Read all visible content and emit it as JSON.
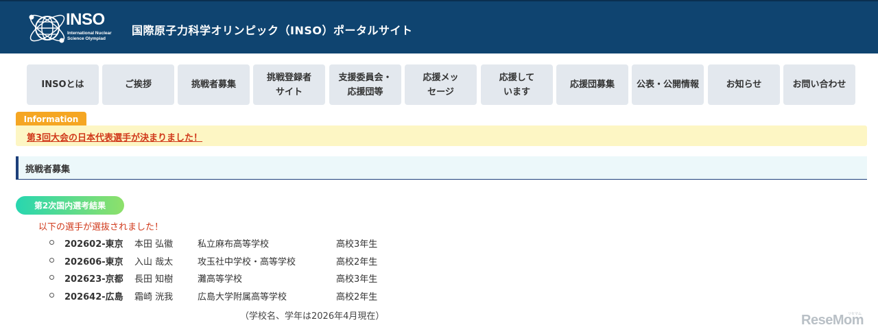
{
  "header": {
    "logo_text": "INSO",
    "logo_sub": "International Nuclear Science Olympiad",
    "site_title": "国際原子力科学オリンピック（INSO）ポータルサイト"
  },
  "nav": [
    {
      "label": "INSOとは"
    },
    {
      "label": "ご挨拶"
    },
    {
      "label": "挑戦者募集"
    },
    {
      "label": "挑戦登録者\nサイト"
    },
    {
      "label": "支援委員会・\n応援団等"
    },
    {
      "label": "応援メッ\nセージ"
    },
    {
      "label": "応援して\nいます"
    },
    {
      "label": "応援団募集"
    },
    {
      "label": "公表・公開情報"
    },
    {
      "label": "お知らせ"
    },
    {
      "label": "お問い合わせ"
    }
  ],
  "info": {
    "tab_label": "Information",
    "link_text": "第3回大会の日本代表選手が決まりました！"
  },
  "section": {
    "heading": "挑戦者募集",
    "pill": "第2次国内選考結果",
    "notice": "以下の選手が選抜されました！",
    "entries": [
      {
        "id": "202602-東京",
        "name": "本田 弘徽",
        "school": "私立麻布高等学校",
        "grade": "高校3年生"
      },
      {
        "id": "202606-東京",
        "name": "入山 哉太",
        "school": "攻玉社中学校・高等学校",
        "grade": "高校2年生"
      },
      {
        "id": "202623-京都",
        "name": "長田 知樹",
        "school": "灘高等学校",
        "grade": "高校3年生"
      },
      {
        "id": "202642-広島",
        "name": "霜崎 洸我",
        "school": "広島大学附属高等学校",
        "grade": "高校2年生"
      }
    ],
    "footnote": "（学校名、学年は2026年4月現在）"
  },
  "watermark": {
    "text": "ReseMom",
    "small": "リセマム"
  },
  "colors": {
    "header_bg": "#0f4470",
    "nav_bg": "#e3e8ee",
    "info_tab": "#f5a623",
    "info_bar": "#fdf6c4",
    "alert_text": "#d0381a",
    "section_accent": "#1d3f7a",
    "pill_start": "#28d6b0",
    "pill_end": "#8ee06a"
  }
}
